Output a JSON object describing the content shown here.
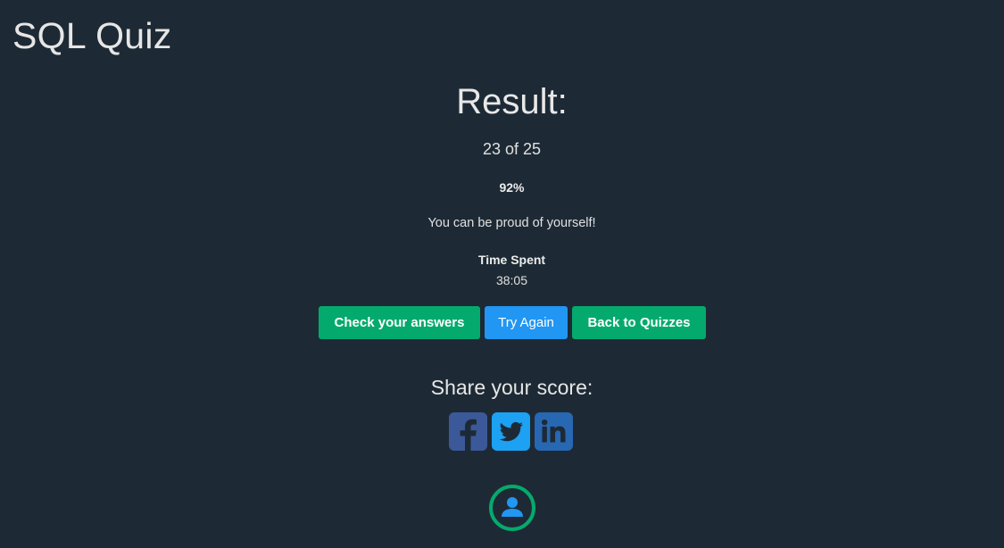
{
  "header": {
    "title": "SQL Quiz"
  },
  "result": {
    "heading": "Result:",
    "score_text": "23 of 25",
    "percent_text": "92%",
    "message": "You can be proud of yourself!",
    "time_label": "Time Spent",
    "time_value": "38:05"
  },
  "buttons": {
    "check_answers": "Check your answers",
    "try_again": "Try Again",
    "back_to_quizzes": "Back to Quizzes"
  },
  "share": {
    "heading": "Share your score:",
    "icons": [
      "facebook-icon",
      "twitter-icon",
      "linkedin-icon"
    ]
  },
  "profile": {
    "icon": "user-icon",
    "progress_ring_color": "#04aa6d"
  },
  "colors": {
    "background": "#1d2a35",
    "accent_green": "#04aa6d",
    "accent_blue": "#2196f3",
    "facebook": "#3b5998",
    "twitter": "#1da1f2",
    "linkedin": "#2867b2"
  }
}
